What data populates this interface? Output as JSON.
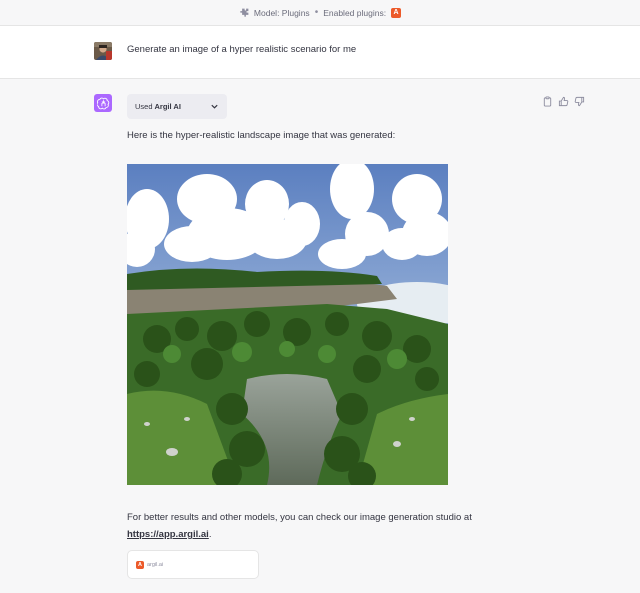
{
  "topbar": {
    "model_text": "Model: Plugins",
    "separator": "•",
    "enabled_text": "Enabled plugins:",
    "plugin_badge": "A"
  },
  "user_message": {
    "text": "Generate an image of a hyper realistic scenario for me"
  },
  "assistant_message": {
    "plugin_used_prefix": "Used",
    "plugin_used_name": "Argil AI",
    "intro_text": "Here is the hyper-realistic landscape image that was generated:",
    "image_alt": "hyper-realistic landscape",
    "followup_text": "For better results and other models, you can check our image generation studio at",
    "link_text": "https://app.argil.ai",
    "link_suffix": ".",
    "source_card": {
      "badge": "A",
      "label": "argil.ai"
    }
  },
  "icons": {
    "plugin": "puzzle-icon",
    "copy": "clipboard-icon",
    "like": "thumbs-up-icon",
    "dislike": "thumbs-down-icon",
    "assistant": "openai-logo-icon",
    "dropdown": "chevron-down-icon"
  },
  "colors": {
    "assistant_avatar": "#ab68ff",
    "argil_brand": "#ec5a2a",
    "background": "#f7f7f8"
  }
}
